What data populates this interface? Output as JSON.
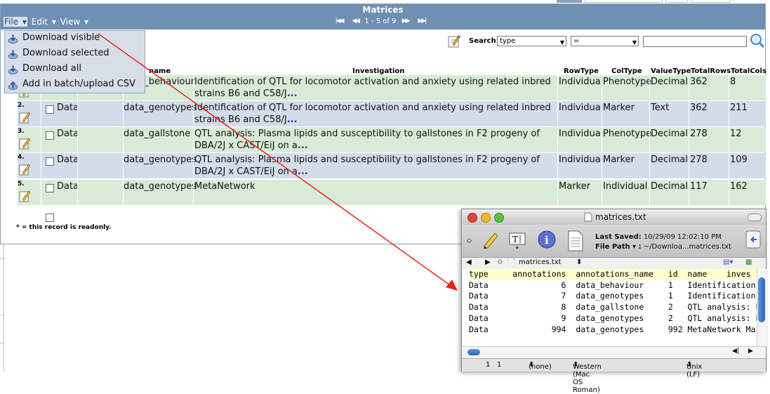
{
  "window": {
    "title": "Matrices"
  },
  "menu": {
    "file": "File",
    "edit": "Edit",
    "view": "View",
    "file_items": [
      "Download visible",
      "Download selected",
      "Download all",
      "Add in batch/upload CSV"
    ]
  },
  "pager": {
    "text": "1 - 5 of 9"
  },
  "search": {
    "label": "Search:",
    "field": "type",
    "operator": "=",
    "value": ""
  },
  "table": {
    "headers": {
      "name": "name",
      "investigation": "Investigation",
      "rowtype": "RowType",
      "coltype": "ColType",
      "valuetype": "ValueType",
      "totalrows": "TotalRows",
      "totalcols": "TotalCols"
    },
    "rows": [
      {
        "num": "1.",
        "type": "",
        "name": "data_behaviour",
        "inv1": "Identification of QTL for locomotor activation and anxiety using related inbred",
        "inv2": "strains B6 and C58/J",
        "more": "...",
        "rowtype": "Individual",
        "coltype": "Phenotype",
        "valuetype": "Decimal",
        "totalrows": "362",
        "totalcols": "8"
      },
      {
        "num": "2.",
        "type": "Data",
        "name": "data_genotypes",
        "inv1": "Identification of QTL for locomotor activation and anxiety using related inbred",
        "inv2": "strains B6 and C58/J",
        "more": "...",
        "rowtype": "Individual",
        "coltype": "Marker",
        "valuetype": "Text",
        "totalrows": "362",
        "totalcols": "211"
      },
      {
        "num": "3.",
        "type": "Data",
        "name": "data_gallstone",
        "inv1": "QTL analysis: Plasma lipids and susceptibility to gallstones in F2 progeny of",
        "inv2": "DBA/2J x CAST/EiJ on a",
        "more": "...",
        "rowtype": "Individual",
        "coltype": "Phenotype",
        "valuetype": "Decimal",
        "totalrows": "278",
        "totalcols": "12"
      },
      {
        "num": "4.",
        "type": "Data",
        "name": "data_genotypes",
        "inv1": "QTL analysis: Plasma lipids and susceptibility to gallstones in F2 progeny of",
        "inv2": "DBA/2J x CAST/EiJ on a",
        "more": "...",
        "rowtype": "Individual",
        "coltype": "Marker",
        "valuetype": "Decimal",
        "totalrows": "278",
        "totalcols": "109"
      },
      {
        "num": "5.",
        "type": "Data",
        "name": "data_genotypes",
        "inv1": "MetaNetwork",
        "inv2": "",
        "more": "",
        "rowtype": "Marker",
        "coltype": "Individual",
        "valuetype": "Decimal",
        "totalrows": "117",
        "totalcols": "162"
      }
    ],
    "footnote": "* = this record is readonly."
  },
  "textedit": {
    "filename": "matrices.txt",
    "last_saved_label": "Last Saved:",
    "last_saved": "10/29/09 12:02:10 PM",
    "file_path_label": "File Path ▾ :",
    "file_path": "~/Downloa...matrices.txt",
    "nav_file": "matrices.txt",
    "lines": [
      "type     annotations  annotations_name   id  name    inves",
      "Data               6  data_behaviour     1   Identification of",
      "Data               7  data_genotypes     1   Identification of",
      "Data               8  data_gallstone     2   QTL analysis: Pla",
      "Data               9  data_genotypes     2   QTL analysis: Pla",
      "Data             994  data_genotypes     992 MetaNetwork Marke"
    ],
    "status": {
      "line": "1",
      "col": "1",
      "markup": "(none)",
      "encoding": "Western (Mac OS Roman)",
      "line_endings": "Unix (LF)"
    }
  },
  "colors": {
    "header": "#6f8fb3",
    "row_green": "#d8ebd7",
    "row_blue": "#d3dde9",
    "arrow": "#e8261c"
  }
}
